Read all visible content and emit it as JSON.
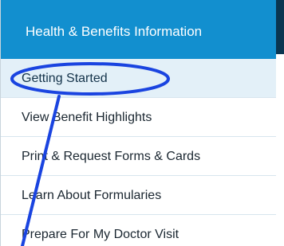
{
  "menu": {
    "header": {
      "label": "Health & Benefits Information"
    },
    "items": [
      {
        "label": "Getting Started",
        "active": true
      },
      {
        "label": "View Benefit Highlights",
        "active": false
      },
      {
        "label": "Print & Request Forms & Cards",
        "active": false
      },
      {
        "label": "Learn About Formularies",
        "active": false
      },
      {
        "label": "Prepare For My Doctor Visit",
        "active": false
      }
    ]
  },
  "annotation": {
    "color": "#1a44e0",
    "target": "Getting Started"
  },
  "colors": {
    "header_bg": "#128fcf",
    "active_item_bg": "#e3f0f8"
  }
}
